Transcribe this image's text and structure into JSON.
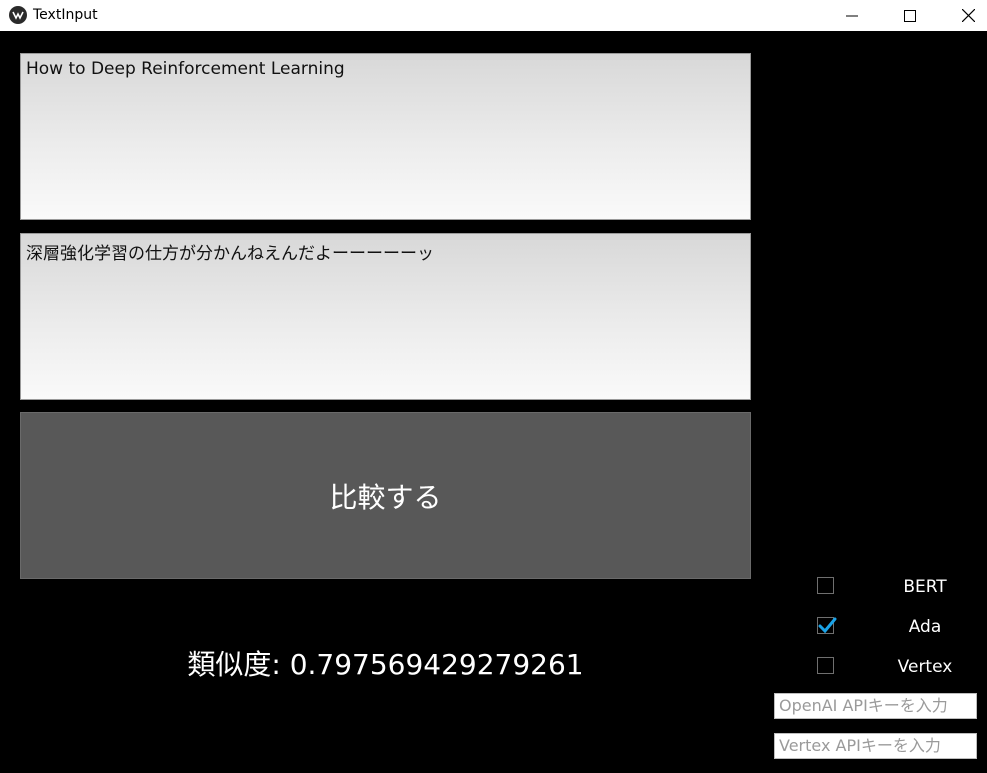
{
  "window": {
    "title": "TextInput"
  },
  "inputs": {
    "text1": "How to Deep Reinforcement Learning",
    "text2": "深層強化学習の仕方が分かんねえんだよーーーーーッ"
  },
  "compare_button": {
    "label": "比較する"
  },
  "result": {
    "similarity_text": "類似度: 0.797569429279261"
  },
  "models": [
    {
      "label": "BERT",
      "checked": false
    },
    {
      "label": "Ada",
      "checked": true
    },
    {
      "label": "Vertex",
      "checked": false
    }
  ],
  "api_keys": {
    "openai_placeholder": "OpenAI APIキーを入力",
    "vertex_placeholder": "Vertex APIキーを入力"
  },
  "colors": {
    "accent": "#1aa3e8",
    "button_bg": "#585858",
    "background": "#000000"
  }
}
